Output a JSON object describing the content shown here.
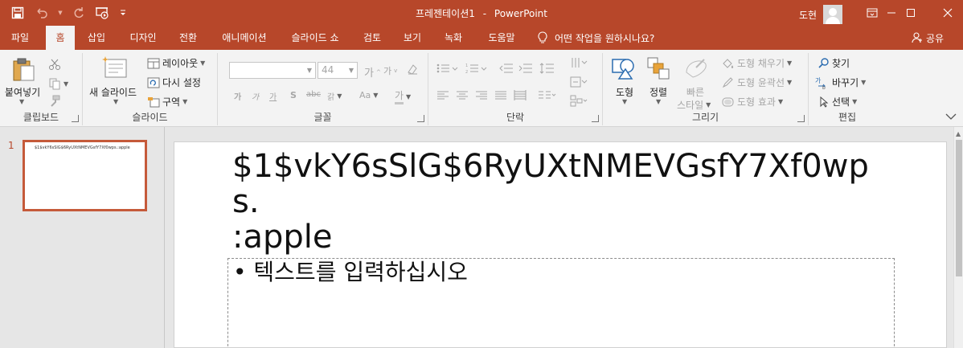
{
  "window": {
    "title": "프레젠테이션1",
    "separator": "-",
    "app_name": "PowerPoint",
    "user_name": "도현"
  },
  "colors": {
    "accent": "#b7472a",
    "ribbon_bg": "#f3f3f3",
    "workspace_bg": "#e6e6e6",
    "thumb_border": "#c55a3a"
  },
  "quick_access": [
    "save-icon",
    "undo-icon",
    "redo-icon",
    "slideshow-icon",
    "customize-icon"
  ],
  "tabs": [
    {
      "label": "파일",
      "active": false
    },
    {
      "label": "홈",
      "active": true
    },
    {
      "label": "삽입",
      "active": false
    },
    {
      "label": "디자인",
      "active": false
    },
    {
      "label": "전환",
      "active": false
    },
    {
      "label": "애니메이션",
      "active": false
    },
    {
      "label": "슬라이드 쇼",
      "active": false
    },
    {
      "label": "검토",
      "active": false
    },
    {
      "label": "보기",
      "active": false
    },
    {
      "label": "녹화",
      "active": false
    },
    {
      "label": "도움말",
      "active": false
    }
  ],
  "tell_me": "어떤 작업을 원하시나요?",
  "share": "공유",
  "ribbon": {
    "clipboard": {
      "label": "클립보드",
      "paste": "붙여넣기"
    },
    "slides": {
      "label": "슬라이드",
      "new_slide": "새 슬라이드",
      "layout": "레이아웃",
      "reset": "다시 설정",
      "section": "구역"
    },
    "font": {
      "label": "글꼴",
      "size": "44",
      "case": "Aa",
      "spacing": "갉",
      "char": "가"
    },
    "paragraph": {
      "label": "단락"
    },
    "drawing": {
      "label": "그리기",
      "shapes": "도형",
      "arrange": "정렬",
      "quick_styles_1": "빠른",
      "quick_styles_2": "스타일",
      "shape_fill": "도형 채우기",
      "shape_outline": "도형 윤곽선",
      "shape_effects": "도형 효과"
    },
    "editing": {
      "label": "편집",
      "find": "찾기",
      "replace": "바꾸기",
      "select": "선택"
    }
  },
  "slides": [
    {
      "number": "1",
      "title": "$1$vkY6sSlG$6RyUXtNMEVGsfY7Xf0wps.:apple"
    }
  ],
  "slide": {
    "title_line1": "$1$vkY6sSlG$6RyUXtNMEVGsfY7Xf0wps.",
    "title_line2": ":apple",
    "content_placeholder": "• 텍스트를 입력하십시오"
  }
}
